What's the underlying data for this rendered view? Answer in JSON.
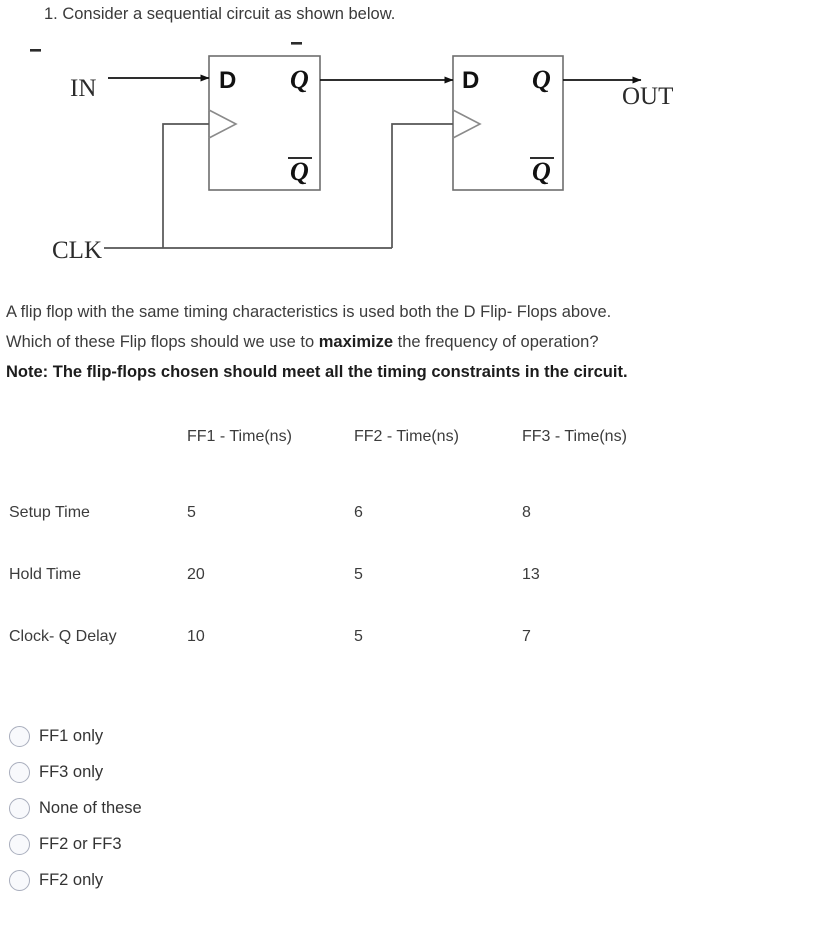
{
  "question": {
    "stem": "1. Consider a sequential circuit as shown below."
  },
  "circuit": {
    "input_label": "IN",
    "output_label": "OUT",
    "clock_label": "CLK",
    "ff1": {
      "d_label": "D",
      "q_label": "Q",
      "qbar_label": "Q",
      "clock_glyph": "clock-triangle"
    },
    "ff2": {
      "d_label": "D",
      "q_label": "Q",
      "qbar_label": "Q",
      "clock_glyph": "clock-triangle"
    },
    "line_color": "#555555",
    "box_stroke": "#6e6e6e"
  },
  "prompt": {
    "line1_part1": "A flip flop with the same timing characteristics is used both the D Flip- Flops above.",
    "line2_part1": "Which of these Flip flops should we use to ",
    "line2_bold": "maximize",
    "line2_part2": " the frequency of operation?",
    "note": "Note: The flip-flops chosen should meet all the timing constraints in the circuit."
  },
  "table": {
    "headers": [
      "",
      "FF1 - Time(ns)",
      "FF2 - Time(ns)",
      "FF3 - Time(ns)"
    ],
    "rows": [
      {
        "label": "Setup Time",
        "values": [
          "5",
          "6",
          "8"
        ]
      },
      {
        "label": "Hold Time",
        "values": [
          "20",
          "5",
          "13"
        ]
      },
      {
        "label": "Clock- Q Delay",
        "values": [
          "10",
          "5",
          "7"
        ]
      }
    ]
  },
  "options": [
    {
      "label": "FF1 only",
      "selected": false
    },
    {
      "label": "FF3 only",
      "selected": false
    },
    {
      "label": "None of these",
      "selected": false
    },
    {
      "label": "FF2 or FF3",
      "selected": false
    },
    {
      "label": "FF2 only",
      "selected": false
    }
  ]
}
